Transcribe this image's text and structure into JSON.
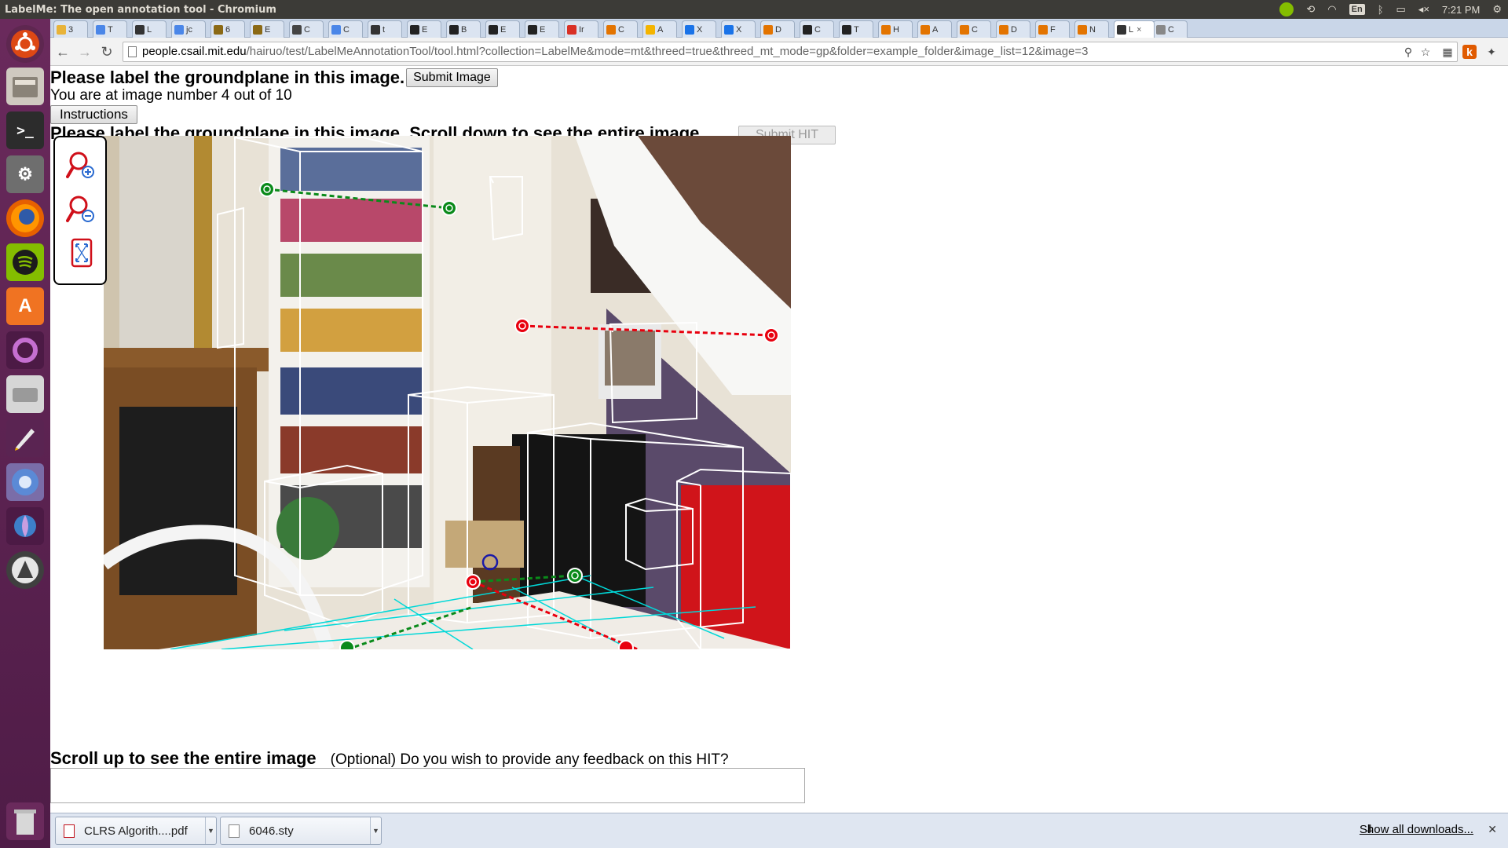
{
  "system_panel": {
    "window_title": "LabelMe: The open annotation tool - Chromium",
    "language": "En",
    "clock": "7:21 PM"
  },
  "browser": {
    "tabs": [
      {
        "label": "3",
        "color": "#e8b339"
      },
      {
        "label": "T",
        "color": "#4a86e8"
      },
      {
        "label": "L",
        "color": "#333333"
      },
      {
        "label": "jc",
        "color": "#4a86e8"
      },
      {
        "label": "6",
        "color": "#8b6914"
      },
      {
        "label": "E",
        "color": "#8b6914"
      },
      {
        "label": "C",
        "color": "#444444"
      },
      {
        "label": "C",
        "color": "#4a86e8"
      },
      {
        "label": "t",
        "color": "#333333"
      },
      {
        "label": "E",
        "color": "#222222"
      },
      {
        "label": "B",
        "color": "#222222"
      },
      {
        "label": "E",
        "color": "#222222"
      },
      {
        "label": "E",
        "color": "#222222"
      },
      {
        "label": "Ir",
        "color": "#d93025"
      },
      {
        "label": "C",
        "color": "#e37400"
      },
      {
        "label": "A",
        "color": "#f4b400"
      },
      {
        "label": "X",
        "color": "#1a73e8"
      },
      {
        "label": "X",
        "color": "#1a73e8"
      },
      {
        "label": "D",
        "color": "#e37400"
      },
      {
        "label": "C",
        "color": "#222222"
      },
      {
        "label": "T",
        "color": "#222222"
      },
      {
        "label": "H",
        "color": "#e37400"
      },
      {
        "label": "A",
        "color": "#e37400"
      },
      {
        "label": "C",
        "color": "#e37400"
      },
      {
        "label": "D",
        "color": "#e37400"
      },
      {
        "label": "F",
        "color": "#e37400"
      },
      {
        "label": "N",
        "color": "#e37400"
      },
      {
        "label": "L",
        "color": "#333333"
      },
      {
        "label": "C",
        "color": "#888888"
      }
    ],
    "active_tab_index": 27,
    "url_host": "people.csail.mit.edu",
    "url_path": "/hairuo/test/LabelMeAnnotationTool/tool.html?collection=LabelMe&mode=mt&threed=true&threed_mt_mode=gp&folder=example_folder&image_list=12&image=3"
  },
  "page": {
    "heading": "Please label the groundplane in this image.",
    "submit_image_label": "Submit Image",
    "image_counter": "You are at image number 4 out of 10",
    "instructions_label": "Instructions",
    "heading2": "Please label the groundplane in this image. Scroll down to see the entire image.",
    "submit_hit_label": "Submit HIT",
    "scroll_up_text": "Scroll up to see the entire image",
    "feedback_label": "(Optional) Do you wish to provide any feedback on this HIT?",
    "feedback_value": ""
  },
  "toolbox": {
    "tools": [
      "zoom-in-icon",
      "zoom-out-icon",
      "fit-to-screen-icon"
    ]
  },
  "downloads": {
    "items": [
      {
        "name": "CLRS Algorith....pdf",
        "type": "pdf"
      },
      {
        "name": "6046.sty",
        "type": "file"
      }
    ],
    "show_all_label": "Show all downloads..."
  },
  "colors": {
    "accent_red": "#e8000e",
    "accent_green": "#0a8a1a",
    "accent_cyan": "#00c8c8",
    "launcher_bg": "#5d1f4f"
  }
}
